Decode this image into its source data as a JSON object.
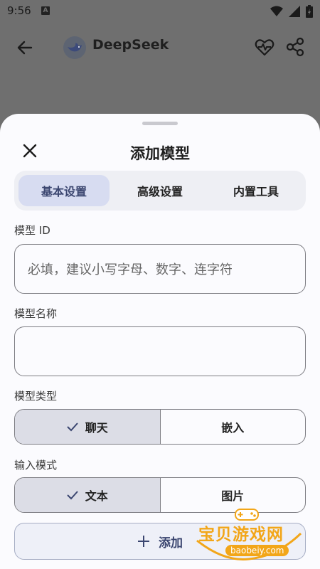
{
  "status_bar": {
    "time": "9:56",
    "notif_icon": "A"
  },
  "app_bar": {
    "title": "DeepSeek"
  },
  "sheet": {
    "title": "添加模型",
    "tabs": [
      {
        "label": "基本设置",
        "active": true
      },
      {
        "label": "高级设置",
        "active": false
      },
      {
        "label": "内置工具",
        "active": false
      }
    ],
    "model_id": {
      "label": "模型 ID",
      "placeholder": "必填，建议小写字母、数字、连字符",
      "value": ""
    },
    "model_name": {
      "label": "模型名称",
      "placeholder": "",
      "value": ""
    },
    "model_type": {
      "label": "模型类型",
      "options": [
        "聊天",
        "嵌入"
      ],
      "selected": "聊天"
    },
    "input_mode": {
      "label": "输入模式",
      "options": [
        "文本",
        "图片"
      ],
      "selected": "文本"
    },
    "add_button": {
      "label": "添加"
    }
  },
  "watermark": {
    "text": "宝贝游戏网",
    "url": "baobeiy.com"
  },
  "colors": {
    "accent": "#3b4670",
    "tab_active_bg": "#d7dcf1",
    "scrim": "#6f6f6f",
    "watermark": "#f2a619"
  }
}
